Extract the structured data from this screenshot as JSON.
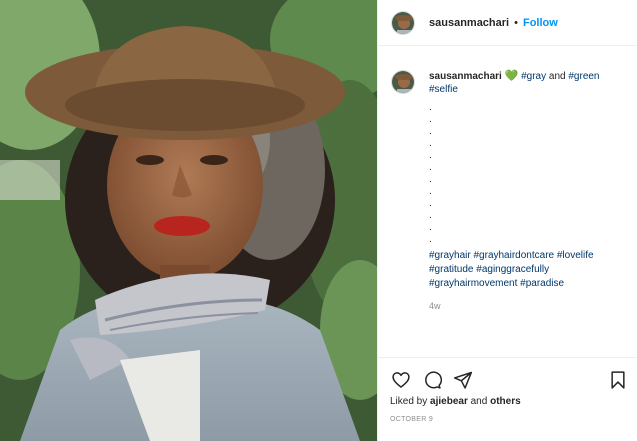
{
  "post": {
    "username": "sausanmachari",
    "dot": "•",
    "follow_label": "Follow"
  },
  "caption": {
    "username": "sausanmachari",
    "heart": "💚",
    "tag_gray": "#gray",
    "and": "and",
    "tag_green": "#green",
    "tag_selfie": "#selfie",
    "dots": [
      ".",
      ".",
      ".",
      ".",
      ".",
      ".",
      ".",
      ".",
      ".",
      ".",
      ".",
      "."
    ],
    "hashtags": [
      "#grayhair",
      "#grayhairdontcare",
      "#lovelife",
      "#gratitude",
      "#aginggracefully",
      "#grayhairmovement",
      "#paradise"
    ],
    "time": "4w"
  },
  "actions": {
    "liked_prefix": "Liked by",
    "liked_user": "ajiebear",
    "liked_and": "and",
    "liked_others": "others",
    "date": "OCTOBER 9"
  },
  "icons": [
    "heart-icon",
    "comment-icon",
    "share-icon",
    "bookmark-icon"
  ],
  "colors": {
    "follow": "#0095f6",
    "hashtag": "#00376b",
    "muted": "#8e8e8e"
  }
}
